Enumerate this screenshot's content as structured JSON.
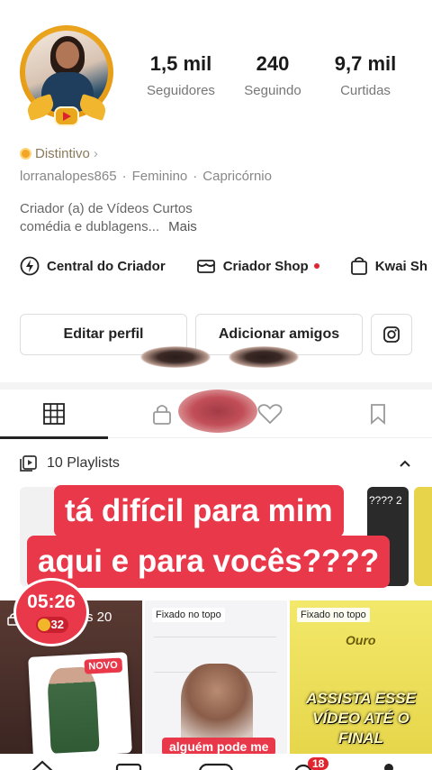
{
  "profile": {
    "stats": [
      {
        "value": "1,5 mil",
        "label": "Seguidores"
      },
      {
        "value": "240",
        "label": "Seguindo"
      },
      {
        "value": "9,7 mil",
        "label": "Curtidas"
      }
    ],
    "badge_label": "Distintivo",
    "username": "lorranalopes865",
    "gender": "Feminino",
    "sign": "Capricórnio",
    "bio_line1": "Criador (a) de Vídeos Curtos",
    "bio_line2": "comédia e dublagens...",
    "bio_more": "Mais"
  },
  "creator_links": [
    {
      "label": "Central do Criador"
    },
    {
      "label": "Criador Shop"
    },
    {
      "label": "Kwai Sh"
    }
  ],
  "buttons": {
    "edit_profile": "Editar perfil",
    "add_friends": "Adicionar amigos"
  },
  "playlists": {
    "label": "10 Playlists",
    "card_counts": [
      "???? 2"
    ]
  },
  "caption": {
    "line1": "tá difícil para mim",
    "line2": "aqui e para vocês????"
  },
  "grid": {
    "timer": "05:26",
    "coin": "32",
    "partial_text": "s 20",
    "novo": "NOVO",
    "pinned_1": "Fixado no topo",
    "pinned_2": "Fixado no topo",
    "ouro": "Ouro",
    "assista_1": "ASSISTA ESSE",
    "assista_2": "VÍDEO ATÉ O FINAL",
    "alguem": "alguém pode me"
  },
  "nav": {
    "badge": "18"
  },
  "colors": {
    "accent_red": "#e8384a",
    "gold": "#e9a71d"
  }
}
